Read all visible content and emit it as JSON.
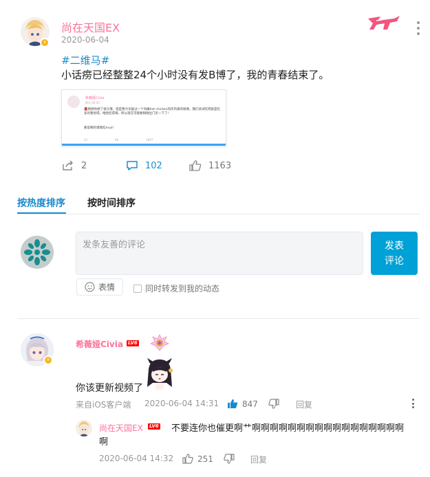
{
  "post": {
    "author": "尚在天国EX",
    "date": "2020-06-04",
    "hashtag": "#二维马#",
    "content": "小话痨已经整整24个小时没有发B博了，我的青春结束了。",
    "embed": {
      "author": "希薇娅Civia",
      "date": "昨天 00:10",
      "text": "📕啊想你想了很久哦，但是我今天挨过一个叫做hot chicken的炸鸡真的很辣，我们试试吃吧就是吃多的我觉得。哈哈吃得嗨，所以现在可能要稍微出门买一下了!",
      "text2": "那说啊的请我吃mua!",
      "footer": [
        "12",
        "46",
        "1097"
      ]
    },
    "actions": {
      "share_count": "2",
      "comment_count": "102",
      "like_count": "1163"
    }
  },
  "tabs": {
    "hot": "按热度排序",
    "time": "按时间排序"
  },
  "composer": {
    "placeholder": "发条友善的评论",
    "send_line1": "发表",
    "send_line2": "评论",
    "emoji_label": "表情",
    "repost_label": "同时转发到我的动态"
  },
  "comments": [
    {
      "author": "希薇娅Civia",
      "level": "LV6",
      "text": "你该更新视频了",
      "source": "来自iOS客户端",
      "time": "2020-06-04 14:31",
      "likes": "847",
      "reply_label": "回复",
      "replies": [
        {
          "author": "尚在天国EX",
          "level": "LV6",
          "text_line1": "不要连你也催更啊艹啊啊啊啊啊啊啊啊啊啊啊啊啊啊啊啊啊",
          "text_line2": "啊",
          "time": "2020-06-04 14:32",
          "likes": "251",
          "reply_label": "回复"
        }
      ]
    }
  ],
  "colors": {
    "accent": "#00a1d6",
    "link": "#178bcf",
    "author_pink": "#fb7299",
    "level_red": "#ff0000"
  },
  "icons": [
    "share-icon",
    "comment-icon",
    "like-icon",
    "dislike-icon",
    "more-icon",
    "emoji-icon",
    "logo-icon"
  ]
}
